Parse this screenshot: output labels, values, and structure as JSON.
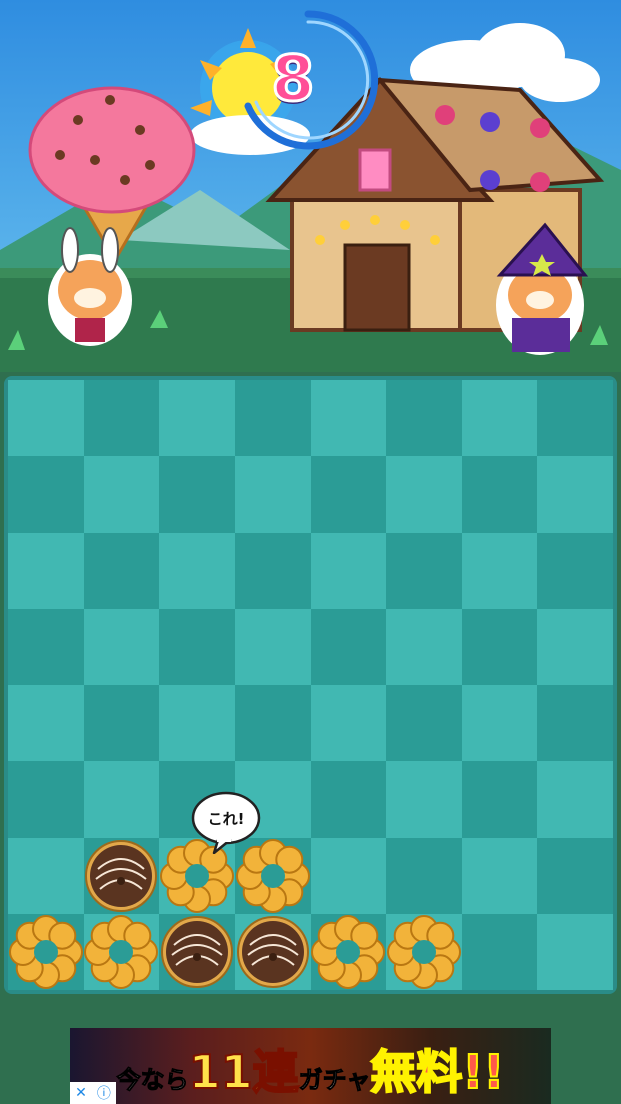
{
  "timer": {
    "value": "8"
  },
  "hint": {
    "label": "これ!"
  },
  "board": {
    "columns": 8,
    "rows": 8,
    "pieces": [
      {
        "row": 7,
        "col": 1,
        "type": "chocolate-donut"
      },
      {
        "row": 7,
        "col": 2,
        "type": "ring-donut"
      },
      {
        "row": 7,
        "col": 3,
        "type": "ring-donut"
      },
      {
        "row": 8,
        "col": 0,
        "type": "ring-donut"
      },
      {
        "row": 8,
        "col": 1,
        "type": "ring-donut"
      },
      {
        "row": 8,
        "col": 2,
        "type": "chocolate-donut"
      },
      {
        "row": 8,
        "col": 3,
        "type": "chocolate-donut"
      },
      {
        "row": 8,
        "col": 4,
        "type": "ring-donut"
      },
      {
        "row": 8,
        "col": 5,
        "type": "ring-donut"
      }
    ]
  },
  "ad": {
    "part1": "今なら",
    "part2": "11連",
    "part3": "ガチャ",
    "part4": "無料!!",
    "close_icon": "close-icon",
    "info_icon": "info-icon"
  },
  "colors": {
    "sky": "#3b9be0",
    "grass": "#2f7a4e",
    "cell_light": "#41b8b2",
    "cell_dark": "#2b9c96",
    "timer_digit": "#ff4f97"
  }
}
